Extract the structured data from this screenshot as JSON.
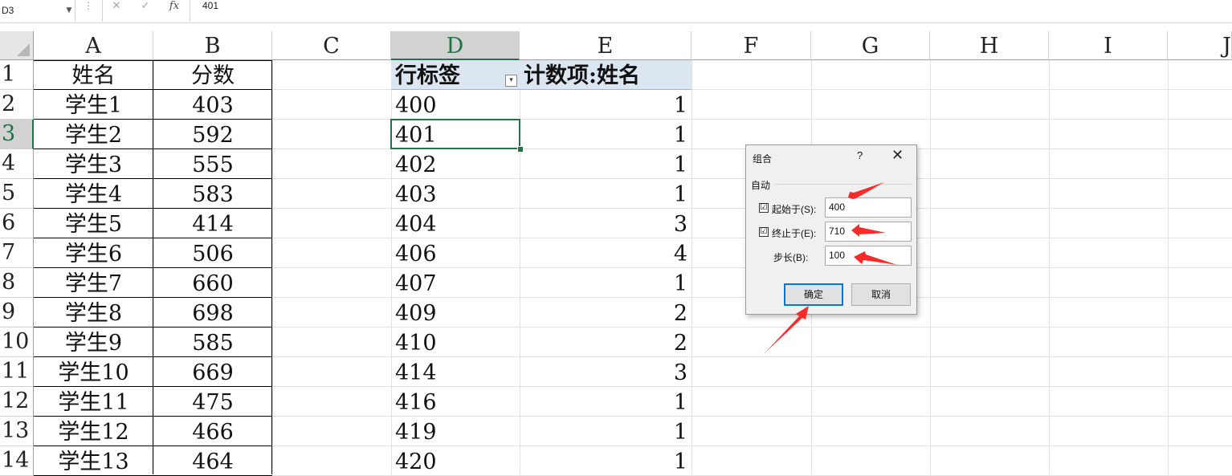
{
  "formula_bar": {
    "name_box": "D3",
    "dots": "⋮",
    "cancel_icon": "✕",
    "enter_icon": "✓",
    "fx_label": "fx",
    "formula": "401"
  },
  "column_headers": [
    "A",
    "B",
    "C",
    "D",
    "E",
    "F",
    "G",
    "H",
    "I",
    "J"
  ],
  "row_headers": [
    "1",
    "2",
    "3",
    "4",
    "5",
    "6",
    "7",
    "8",
    "9",
    "10",
    "11",
    "12",
    "13",
    "14"
  ],
  "table": {
    "headers": {
      "name": "姓名",
      "score": "分数"
    },
    "rows": [
      {
        "name": "学生1",
        "score": "403"
      },
      {
        "name": "学生2",
        "score": "592"
      },
      {
        "name": "学生3",
        "score": "555"
      },
      {
        "name": "学生4",
        "score": "583"
      },
      {
        "name": "学生5",
        "score": "414"
      },
      {
        "name": "学生6",
        "score": "506"
      },
      {
        "name": "学生7",
        "score": "660"
      },
      {
        "name": "学生8",
        "score": "698"
      },
      {
        "name": "学生9",
        "score": "585"
      },
      {
        "name": "学生10",
        "score": "669"
      },
      {
        "name": "学生11",
        "score": "475"
      },
      {
        "name": "学生12",
        "score": "466"
      },
      {
        "name": "学生13",
        "score": "464"
      }
    ]
  },
  "pivot": {
    "row_label_header": "行标签",
    "value_header": "计数项:姓名",
    "rows": [
      {
        "label": "400",
        "count": "1"
      },
      {
        "label": "401",
        "count": "1"
      },
      {
        "label": "402",
        "count": "1"
      },
      {
        "label": "403",
        "count": "1"
      },
      {
        "label": "404",
        "count": "3"
      },
      {
        "label": "406",
        "count": "4"
      },
      {
        "label": "407",
        "count": "1"
      },
      {
        "label": "409",
        "count": "2"
      },
      {
        "label": "410",
        "count": "2"
      },
      {
        "label": "414",
        "count": "3"
      },
      {
        "label": "416",
        "count": "1"
      },
      {
        "label": "419",
        "count": "1"
      },
      {
        "label": "420",
        "count": "1"
      }
    ]
  },
  "dialog": {
    "title": "组合",
    "help": "?",
    "close": "✕",
    "group_label": "自动",
    "start_label": "起始于(S):",
    "start_checked": "☑",
    "start_value": "400",
    "end_label": "终止于(E):",
    "end_checked": "☑",
    "end_value": "710",
    "step_label": "步长(B):",
    "step_value": "100",
    "ok_label": "确定",
    "cancel_label": "取消"
  },
  "colors": {
    "selection_green": "#217346",
    "pivot_header": "#dce6f1",
    "arrow_red": "#ff2a2a",
    "ok_border": "#0078d7"
  }
}
